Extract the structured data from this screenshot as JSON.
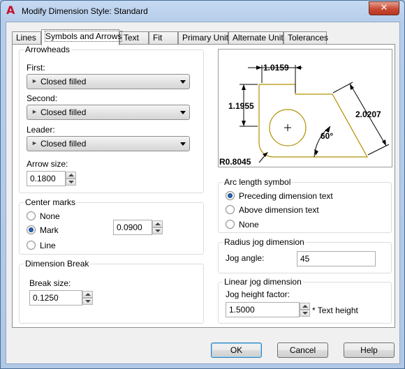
{
  "window": {
    "title": "Modify Dimension Style: Standard",
    "close_glyph": "✕"
  },
  "tabs": [
    "Lines",
    "Symbols and Arrows",
    "Text",
    "Fit",
    "Primary Units",
    "Alternate Units",
    "Tolerances"
  ],
  "arrowheads": {
    "title": "Arrowheads",
    "first_label": "First:",
    "first_value": "Closed filled",
    "second_label": "Second:",
    "second_value": "Closed filled",
    "leader_label": "Leader:",
    "leader_value": "Closed filled",
    "arrow_size_label": "Arrow size:",
    "arrow_size_value": "0.1800",
    "arrow_glyph": "►"
  },
  "center_marks": {
    "title": "Center marks",
    "options": [
      "None",
      "Mark",
      "Line"
    ],
    "selected": "Mark",
    "size_value": "0.0900"
  },
  "dimension_break": {
    "title": "Dimension Break",
    "break_size_label": "Break size:",
    "break_size_value": "0.1250"
  },
  "preview": {
    "top_dim": "1.0159",
    "left_dim": "1.1955",
    "right_dim": "2.0207",
    "angle_dim": "60°",
    "radius_dim": "R0.8045",
    "line_color": "#b38f00"
  },
  "arc_length_symbol": {
    "title": "Arc length symbol",
    "options": [
      "Preceding dimension text",
      "Above dimension text",
      "None"
    ],
    "selected": "Preceding dimension text"
  },
  "radius_jog": {
    "title": "Radius jog dimension",
    "jog_angle_label": "Jog angle:",
    "jog_angle_value": "45"
  },
  "linear_jog": {
    "title": "Linear jog dimension",
    "height_factor_label": "Jog height factor:",
    "height_factor_value": "1.5000",
    "suffix": "* Text height"
  },
  "buttons": {
    "ok": "OK",
    "cancel": "Cancel",
    "help": "Help"
  }
}
